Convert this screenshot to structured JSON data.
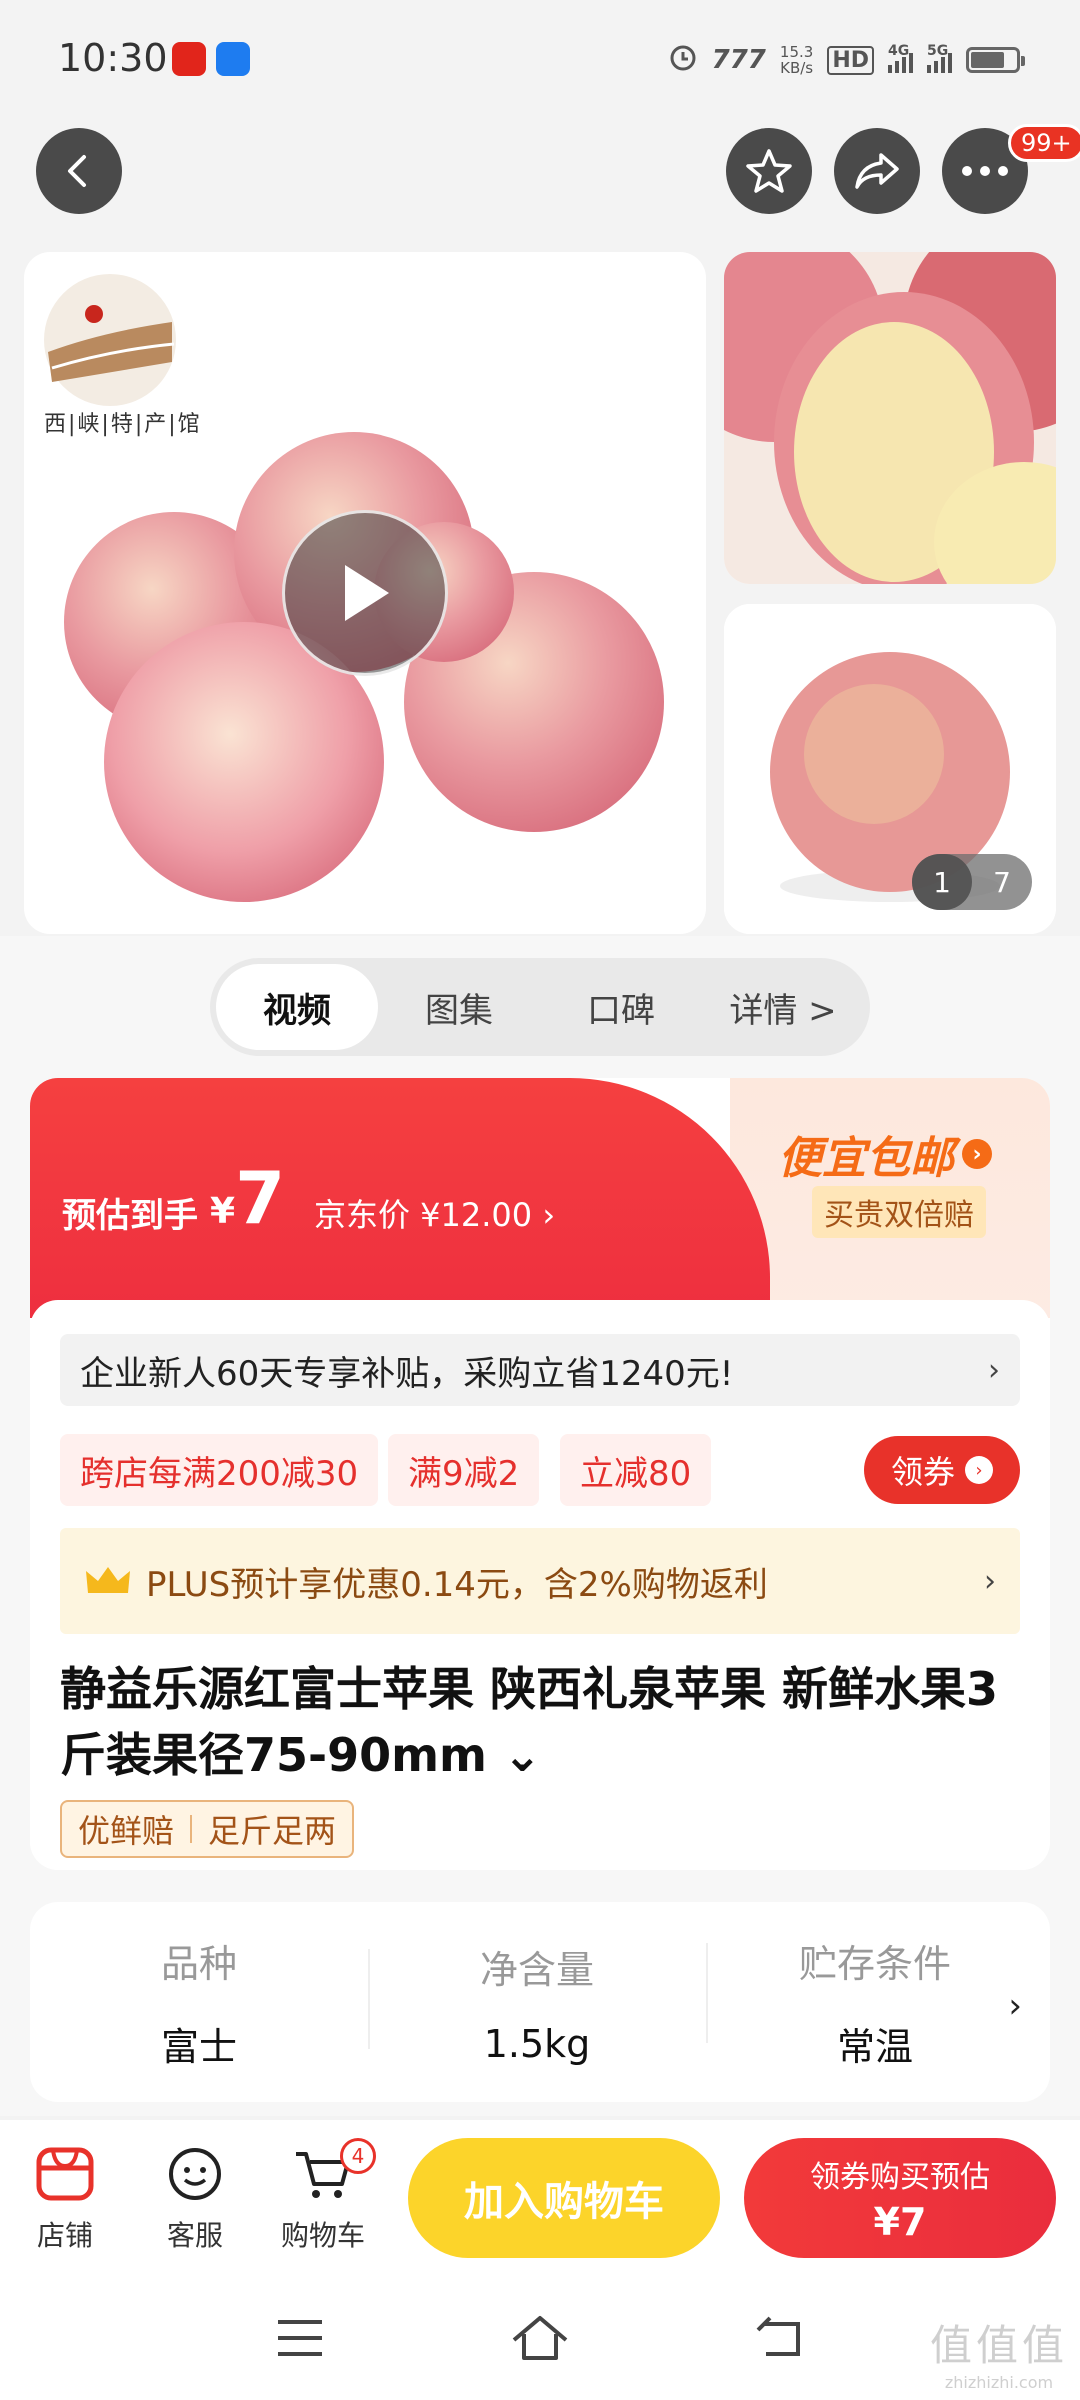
{
  "status": {
    "time": "10:30",
    "net_speed_value": "15.3",
    "net_speed_unit": "KB/s",
    "hd_label": "HD",
    "signal_4g": "4G",
    "signal_5g": "5G",
    "battery_level": 0.75
  },
  "header": {
    "notif_badge": "99+"
  },
  "gallery": {
    "shop_name": "西|峡|特|产|馆",
    "page_current": "1",
    "page_total": "7"
  },
  "tabs": [
    {
      "label": "视频"
    },
    {
      "label": "图集"
    },
    {
      "label": "口碑"
    },
    {
      "label": "详情 >"
    }
  ],
  "price": {
    "estimate_label": "预估到手",
    "currency": "¥",
    "estimate_value": "7",
    "jd_price": "京东价 ¥12.00 ›",
    "cheap_title": "便宜包邮",
    "cheap_sub": "买贵双倍赔"
  },
  "promo": {
    "strip_text": "企业新人60天专享补贴，采购立省1240元!",
    "strip_arrow": "›",
    "coupons": [
      "跨店每满200减30",
      "满9减2",
      "立减80"
    ],
    "get_coupon": "领券",
    "plus_text": "PLUS预计享优惠0.14元，含2%购物返利",
    "plus_arrow": "›"
  },
  "product": {
    "title": "静益乐源红富士苹果 陕西礼泉苹果 新鲜水果3斤装果径75-90mm ⌄",
    "tags": [
      "优鲜赔",
      "足斤足两"
    ]
  },
  "specs": [
    {
      "label": "品种",
      "value": "富士"
    },
    {
      "label": "净含量",
      "value": "1.5kg"
    },
    {
      "label": "贮存条件",
      "value": "常温"
    }
  ],
  "specs_arrow": "›",
  "bottom": {
    "shop": "店铺",
    "service": "客服",
    "cart": "购物车",
    "cart_count": "4",
    "add_cart": "加入购物车",
    "buy_line1": "领券购买预估",
    "buy_line2": "¥7"
  },
  "watermark": {
    "big": "值值值",
    "small": "zhizhizhi.com"
  }
}
